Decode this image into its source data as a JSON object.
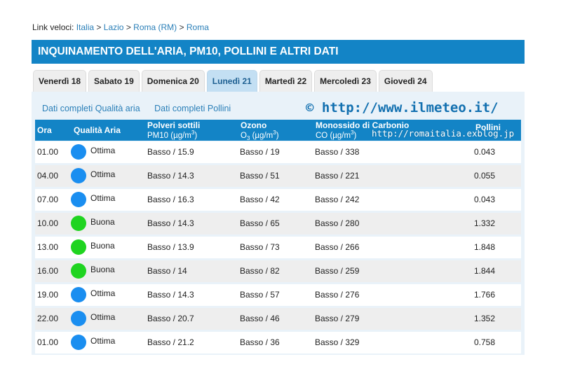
{
  "breadcrumb": {
    "label": "Link veloci:",
    "links": [
      "Italia",
      "Lazio",
      "Roma (RM)",
      "Roma"
    ],
    "separator": ">"
  },
  "title": "INQUINAMENTO DELL'ARIA, PM10, POLLINI E ALTRI DATI",
  "tabs": [
    {
      "label": "Venerdì 18",
      "active": false
    },
    {
      "label": "Sabato 19",
      "active": false
    },
    {
      "label": "Domenica 20",
      "active": false
    },
    {
      "label": "Lunedì 21",
      "active": true
    },
    {
      "label": "Martedì 22",
      "active": false
    },
    {
      "label": "Mercoledì 23",
      "active": false
    },
    {
      "label": "Giovedì 24",
      "active": false
    }
  ],
  "links": {
    "air_quality": "Dati completi Qualità aria",
    "pollen": "Dati completi Pollini"
  },
  "watermark": "© http://www.ilmeteo.it/",
  "watermark2": "http://romaitalia.exblog.jp",
  "table": {
    "headers": {
      "hour": "Ora",
      "quality": "Qualità Aria",
      "pm10_title": "Polveri sottili",
      "pm10_unit": "PM10 (µg/m",
      "ozone_title": "Ozono",
      "ozone_unit_prefix": "O",
      "ozone_unit_sub": "3",
      "ozone_unit_rest": " (µg/m",
      "co_title": "Monossido di Carbonio",
      "co_unit": "CO (µg/m",
      "cube": "3",
      "close": ")",
      "pollen": "Pollini"
    },
    "rows": [
      {
        "hour": "01.00",
        "quality": "Ottima",
        "color": "blue",
        "pm10": "Basso / 15.9",
        "ozone": "Basso / 19",
        "co": "Basso / 338",
        "pollen": "0.043"
      },
      {
        "hour": "04.00",
        "quality": "Ottima",
        "color": "blue",
        "pm10": "Basso / 14.3",
        "ozone": "Basso / 51",
        "co": "Basso / 221",
        "pollen": "0.055"
      },
      {
        "hour": "07.00",
        "quality": "Ottima",
        "color": "blue",
        "pm10": "Basso / 16.3",
        "ozone": "Basso / 42",
        "co": "Basso / 242",
        "pollen": "0.043"
      },
      {
        "hour": "10.00",
        "quality": "Buona",
        "color": "green",
        "pm10": "Basso / 14.3",
        "ozone": "Basso / 65",
        "co": "Basso / 280",
        "pollen": "1.332"
      },
      {
        "hour": "13.00",
        "quality": "Buona",
        "color": "green",
        "pm10": "Basso / 13.9",
        "ozone": "Basso / 73",
        "co": "Basso / 266",
        "pollen": "1.848"
      },
      {
        "hour": "16.00",
        "quality": "Buona",
        "color": "green",
        "pm10": "Basso / 14",
        "ozone": "Basso / 82",
        "co": "Basso / 259",
        "pollen": "1.844"
      },
      {
        "hour": "19.00",
        "quality": "Ottima",
        "color": "blue",
        "pm10": "Basso / 14.3",
        "ozone": "Basso / 57",
        "co": "Basso / 276",
        "pollen": "1.766"
      },
      {
        "hour": "22.00",
        "quality": "Ottima",
        "color": "blue",
        "pm10": "Basso / 20.7",
        "ozone": "Basso / 46",
        "co": "Basso / 279",
        "pollen": "1.352"
      },
      {
        "hour": "01.00",
        "quality": "Ottima",
        "color": "blue",
        "pm10": "Basso / 21.2",
        "ozone": "Basso / 36",
        "co": "Basso / 329",
        "pollen": "0.758"
      }
    ]
  },
  "colors": {
    "header_blue": "#1384c6",
    "link_blue": "#2a7fb8",
    "active_tab": "#c3dff3",
    "quality_blue": "#1a8ef0",
    "quality_green": "#1fd420"
  }
}
